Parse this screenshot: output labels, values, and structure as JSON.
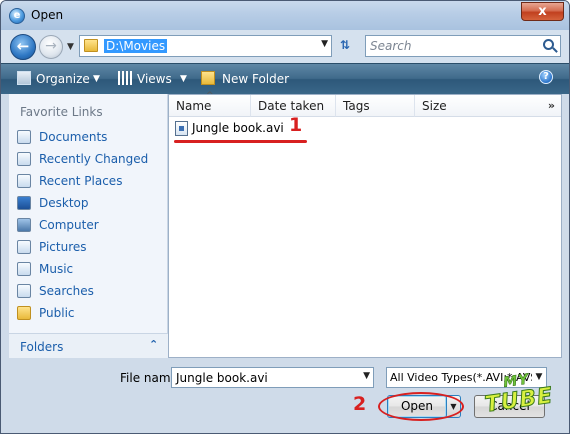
{
  "window": {
    "title": "Open",
    "close_glyph": "x"
  },
  "address_bar": {
    "path": "D:\\Movies"
  },
  "search": {
    "placeholder": "Search"
  },
  "toolbar": {
    "organize_label": "Organize",
    "views_label": "Views",
    "new_folder_label": "New Folder",
    "help_glyph": "?"
  },
  "nav": {
    "heading": "Favorite Links",
    "items": [
      {
        "label": "Documents",
        "icon": "documents-icon"
      },
      {
        "label": "Recently Changed",
        "icon": "recently-changed-icon"
      },
      {
        "label": "Recent Places",
        "icon": "recent-places-icon"
      },
      {
        "label": "Desktop",
        "icon": "desktop-icon"
      },
      {
        "label": "Computer",
        "icon": "computer-icon"
      },
      {
        "label": "Pictures",
        "icon": "pictures-icon"
      },
      {
        "label": "Music",
        "icon": "music-icon"
      },
      {
        "label": "Searches",
        "icon": "searches-icon"
      },
      {
        "label": "Public",
        "icon": "public-icon"
      }
    ],
    "folders_label": "Folders"
  },
  "file_list": {
    "columns": [
      "Name",
      "Date taken",
      "Tags",
      "Size"
    ],
    "more_glyph": "»",
    "files": [
      {
        "name": "Jungle book.avi",
        "icon": "video-file-icon"
      }
    ]
  },
  "annotations": {
    "marker_1": "1",
    "marker_2": "2"
  },
  "bottom": {
    "file_name_label": "File name:",
    "file_name_value": "Jungle book.avi",
    "file_type_value": "All Video Types(*.AVI;*.AVS;*",
    "open_label": "Open",
    "cancel_label": "Cancel"
  },
  "watermark": {
    "top": "MY",
    "bottom": "TUBE"
  },
  "colors": {
    "accent_red": "#d82020",
    "link_blue": "#1b5eab",
    "toolbar": "#3f6a8b"
  }
}
